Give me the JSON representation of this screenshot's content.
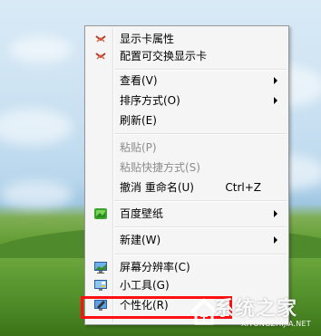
{
  "menu": {
    "items": [
      {
        "label": "显示卡属性",
        "icon": "graphics-card-icon"
      },
      {
        "label": "配置可交换显示卡",
        "icon": "graphics-card-icon"
      },
      {
        "label": "查看(V)",
        "submenu": true
      },
      {
        "label": "排序方式(O)",
        "submenu": true
      },
      {
        "label": "刷新(E)"
      },
      {
        "label": "粘贴(P)",
        "disabled": true
      },
      {
        "label": "粘贴快捷方式(S)",
        "disabled": true
      },
      {
        "label": "撤消 重命名(U)",
        "shortcut": "Ctrl+Z"
      },
      {
        "label": "百度壁纸",
        "icon": "baidu-wallpaper-icon",
        "submenu": true
      },
      {
        "label": "新建(W)",
        "submenu": true
      },
      {
        "label": "屏幕分辨率(C)",
        "icon": "screen-resolution-icon"
      },
      {
        "label": "小工具(G)",
        "icon": "gadgets-icon"
      },
      {
        "label": "个性化(R)",
        "icon": "personalize-icon"
      }
    ]
  },
  "watermark": {
    "title": "系统之家",
    "url": "XITONGZHIJIA.NET"
  },
  "colors": {
    "highlight_border": "#ff1010",
    "menu_background": "#f5f5f5"
  }
}
